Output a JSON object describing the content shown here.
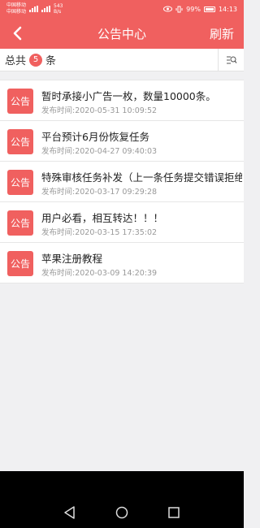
{
  "status_bar": {
    "carrier_1": "中国移动",
    "carrier_2": "中国移动",
    "net_speed_value": "543",
    "net_speed_unit": "B/s",
    "battery": "99%",
    "time": "14:13"
  },
  "header": {
    "title": "公告中心",
    "refresh_label": "刷新"
  },
  "summary": {
    "prefix": "总共",
    "count": "5",
    "suffix": "条"
  },
  "notices": [
    {
      "tag": "公告",
      "title": "暂时承接小广告一枚，数量10000条。",
      "time": "发布时间:2020-05-31 10:09:52"
    },
    {
      "tag": "公告",
      "title": "平台预计6月份恢复任务",
      "time": "发布时间:2020-04-27 09:40:03"
    },
    {
      "tag": "公告",
      "title": "特殊审核任务补发（上一条任务提交错误拒绝的，",
      "time": "发布时间:2020-03-17 09:29:28"
    },
    {
      "tag": "公告",
      "title": "用户必看，相互转达！！！",
      "time": "发布时间:2020-03-15 17:35:02"
    },
    {
      "tag": "公告",
      "title": "苹果注册教程",
      "time": "发布时间:2020-03-09 14:20:39"
    }
  ],
  "icons": {
    "back": "chevron-left-icon",
    "filter": "search-list-icon",
    "nav_back": "triangle-back-icon",
    "nav_home": "circle-home-icon",
    "nav_recent": "square-recent-icon"
  },
  "colors": {
    "accent": "#f0605f",
    "background": "#f0f0f2",
    "nav_bar": "#000000"
  }
}
